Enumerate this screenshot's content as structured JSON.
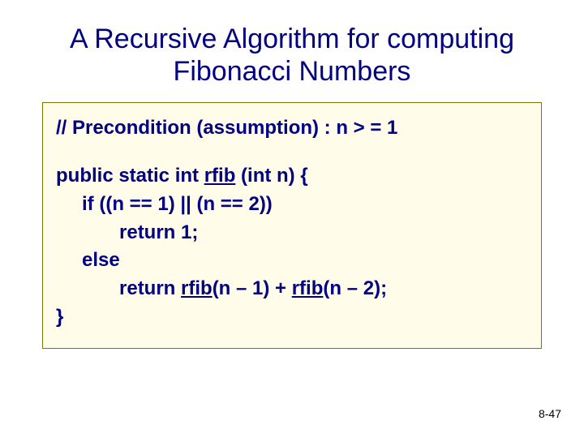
{
  "title": "A Recursive Algorithm for computing Fibonacci Numbers",
  "code": {
    "comment": "// Precondition (assumption) : n > = 1",
    "sig_pre": "public static int ",
    "sig_fn": "rfib",
    "sig_post": " (int n) {",
    "if_line": "if ((n == 1) || (n == 2))",
    "ret1": "return 1;",
    "else_line": "else",
    "ret2_pre": "return ",
    "ret2_fn1": "rfib",
    "ret2_mid": "(n – 1) + ",
    "ret2_fn2": "rfib",
    "ret2_post": "(n – 2);",
    "close": "}"
  },
  "pagenum": "8-47"
}
